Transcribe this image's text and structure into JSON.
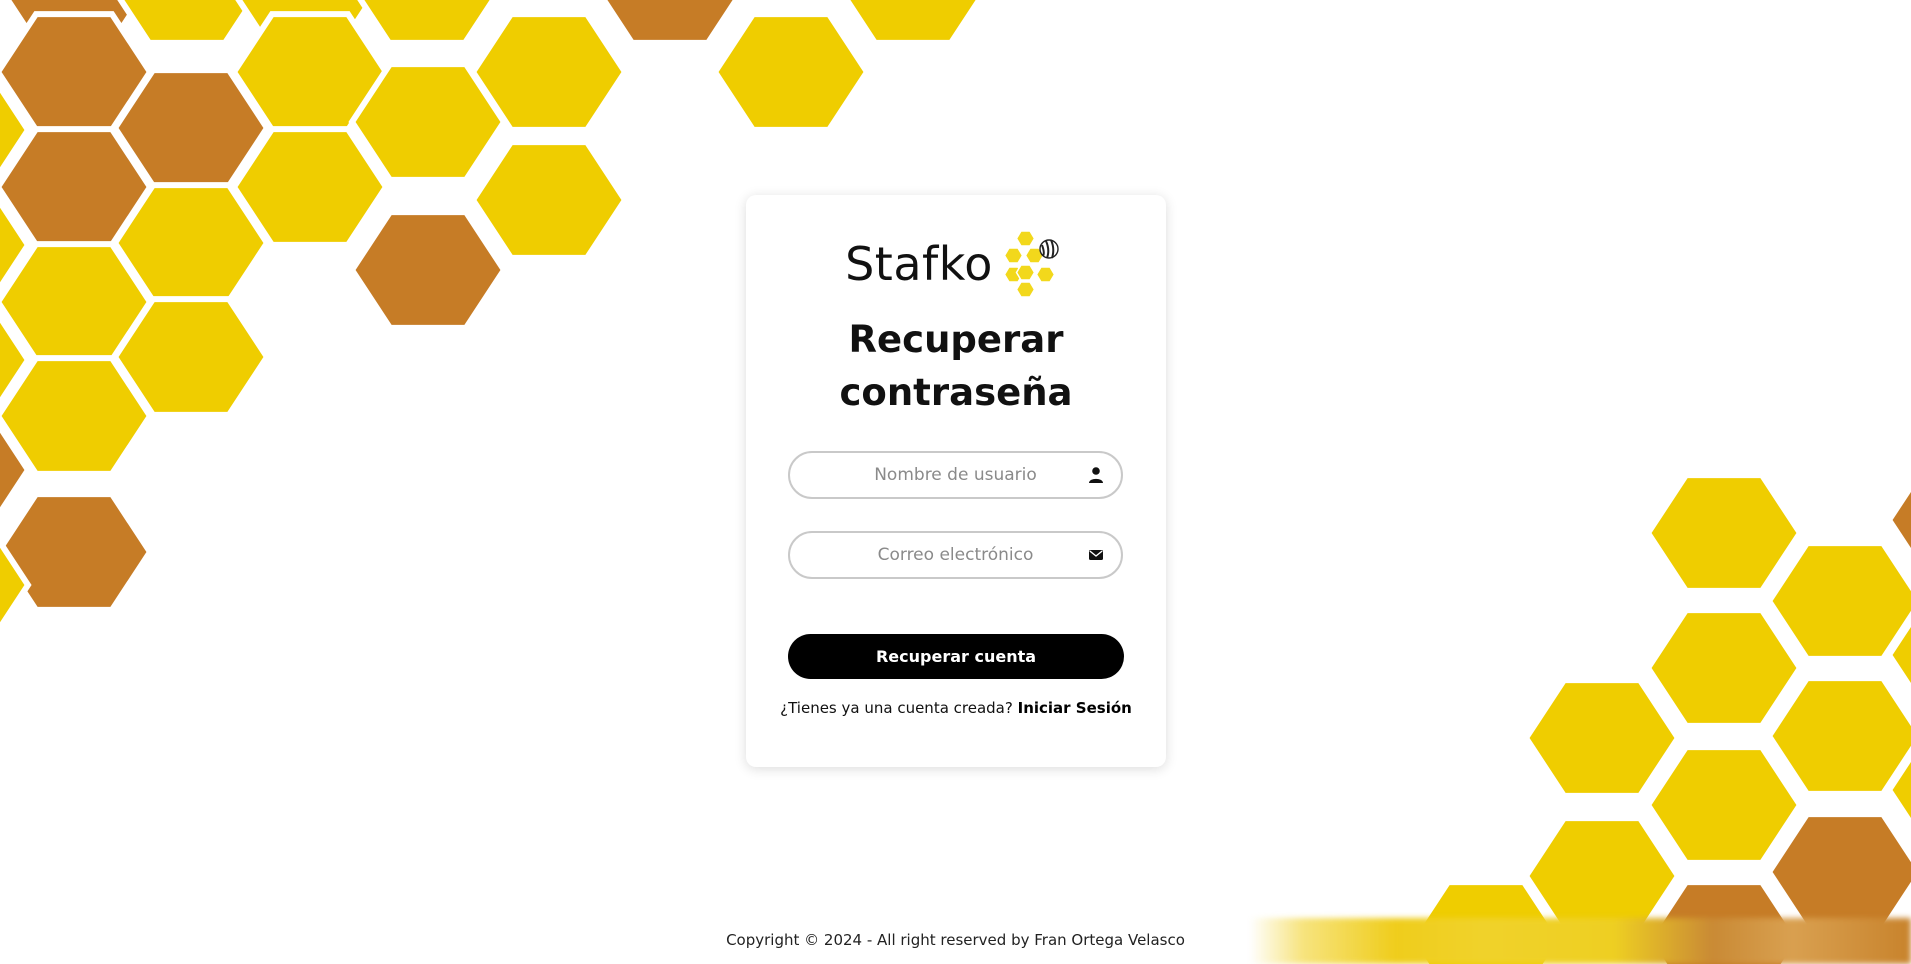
{
  "brand": {
    "name": "Stafko"
  },
  "page": {
    "title": "Recuperar contraseña"
  },
  "form": {
    "username_placeholder": "Nombre de usuario",
    "username_value": "",
    "email_placeholder": "Correo electrónico",
    "email_value": "",
    "submit_label": "Recuperar cuenta"
  },
  "signin_prompt": {
    "question": "¿Tienes ya una cuenta creada?",
    "link_label": "Iniciar Sesión"
  },
  "footer": {
    "copyright": "Copyright © 2024 - All right reserved by Fran Ortega Velasco"
  },
  "icons": {
    "username": "user-icon",
    "email": "envelope-icon",
    "logo_mark": "honeycomb-bee-icon"
  },
  "colors": {
    "hex_yellow": "#efcd00",
    "hex_brown": "#c67c26",
    "button_bg": "#000000",
    "button_text": "#ffffff"
  }
}
